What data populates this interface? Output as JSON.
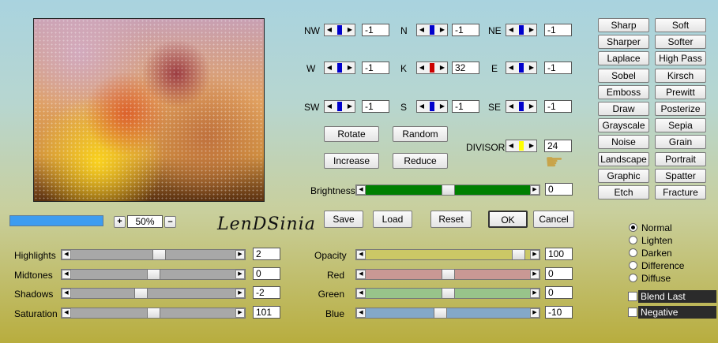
{
  "preview": {
    "zoom_value": "50%",
    "zoom_plus": "+",
    "zoom_minus": "–"
  },
  "logo_text": "LenDSinia",
  "matrix": {
    "NW": {
      "label": "NW",
      "value": "-1",
      "thumb_color": "#0000cc"
    },
    "N": {
      "label": "N",
      "value": "-1",
      "thumb_color": "#0000cc"
    },
    "NE": {
      "label": "NE",
      "value": "-1",
      "thumb_color": "#0000cc"
    },
    "W": {
      "label": "W",
      "value": "-1",
      "thumb_color": "#0000cc"
    },
    "K": {
      "label": "K",
      "value": "32",
      "thumb_color": "#cc0000"
    },
    "E": {
      "label": "E",
      "value": "-1",
      "thumb_color": "#0000cc"
    },
    "SW": {
      "label": "SW",
      "value": "-1",
      "thumb_color": "#0000cc"
    },
    "S": {
      "label": "S",
      "value": "-1",
      "thumb_color": "#0000cc"
    },
    "SE": {
      "label": "SE",
      "value": "-1",
      "thumb_color": "#0000cc"
    }
  },
  "divisor": {
    "label": "DIVISOR",
    "value": "24",
    "thumb_color": "#ffff00"
  },
  "mid_buttons": {
    "rotate": "Rotate",
    "random": "Random",
    "increase": "Increase",
    "reduce": "Reduce"
  },
  "brightness": {
    "label": "Brightness",
    "value": "0",
    "level": 0.5,
    "color": "#008000"
  },
  "action_buttons": {
    "save": "Save",
    "load": "Load",
    "reset": "Reset",
    "ok": "OK",
    "cancel": "Cancel"
  },
  "left_sliders": [
    {
      "label": "Highlights",
      "value": "2",
      "level": 0.54
    },
    {
      "label": "Midtones",
      "value": "0",
      "level": 0.5
    },
    {
      "label": "Shadows",
      "value": "-2",
      "level": 0.42
    },
    {
      "label": "Saturation",
      "value": "101",
      "level": 0.5
    }
  ],
  "right_sliders": [
    {
      "label": "Opacity",
      "value": "100",
      "level": 0.97,
      "color": "#cbc866"
    },
    {
      "label": "Red",
      "value": "0",
      "level": 0.5,
      "color": "#c99894"
    },
    {
      "label": "Green",
      "value": "0",
      "level": 0.5,
      "color": "#98c48a"
    },
    {
      "label": "Blue",
      "value": "-10",
      "level": 0.45,
      "color": "#84a8c8"
    }
  ],
  "presets": [
    [
      "Sharp",
      "Soft"
    ],
    [
      "Sharper",
      "Softer"
    ],
    [
      "Laplace",
      "High Pass"
    ],
    [
      "Sobel",
      "Kirsch"
    ],
    [
      "Emboss",
      "Prewitt"
    ],
    [
      "Draw",
      "Posterize"
    ],
    [
      "Grayscale",
      "Sepia"
    ],
    [
      "Noise",
      "Grain"
    ],
    [
      "Landscape",
      "Portrait"
    ],
    [
      "Graphic",
      "Spatter"
    ],
    [
      "Etch",
      "Fracture"
    ]
  ],
  "blend_modes": {
    "options": [
      "Normal",
      "Lighten",
      "Darken",
      "Difference",
      "Diffuse"
    ],
    "selected": "Normal"
  },
  "checks": {
    "blend_last": "Blend Last",
    "negative": "Negative"
  },
  "arrows": {
    "left": "◀",
    "right": "▶"
  },
  "icons": {
    "pointer": "pointing-hand-icon"
  }
}
